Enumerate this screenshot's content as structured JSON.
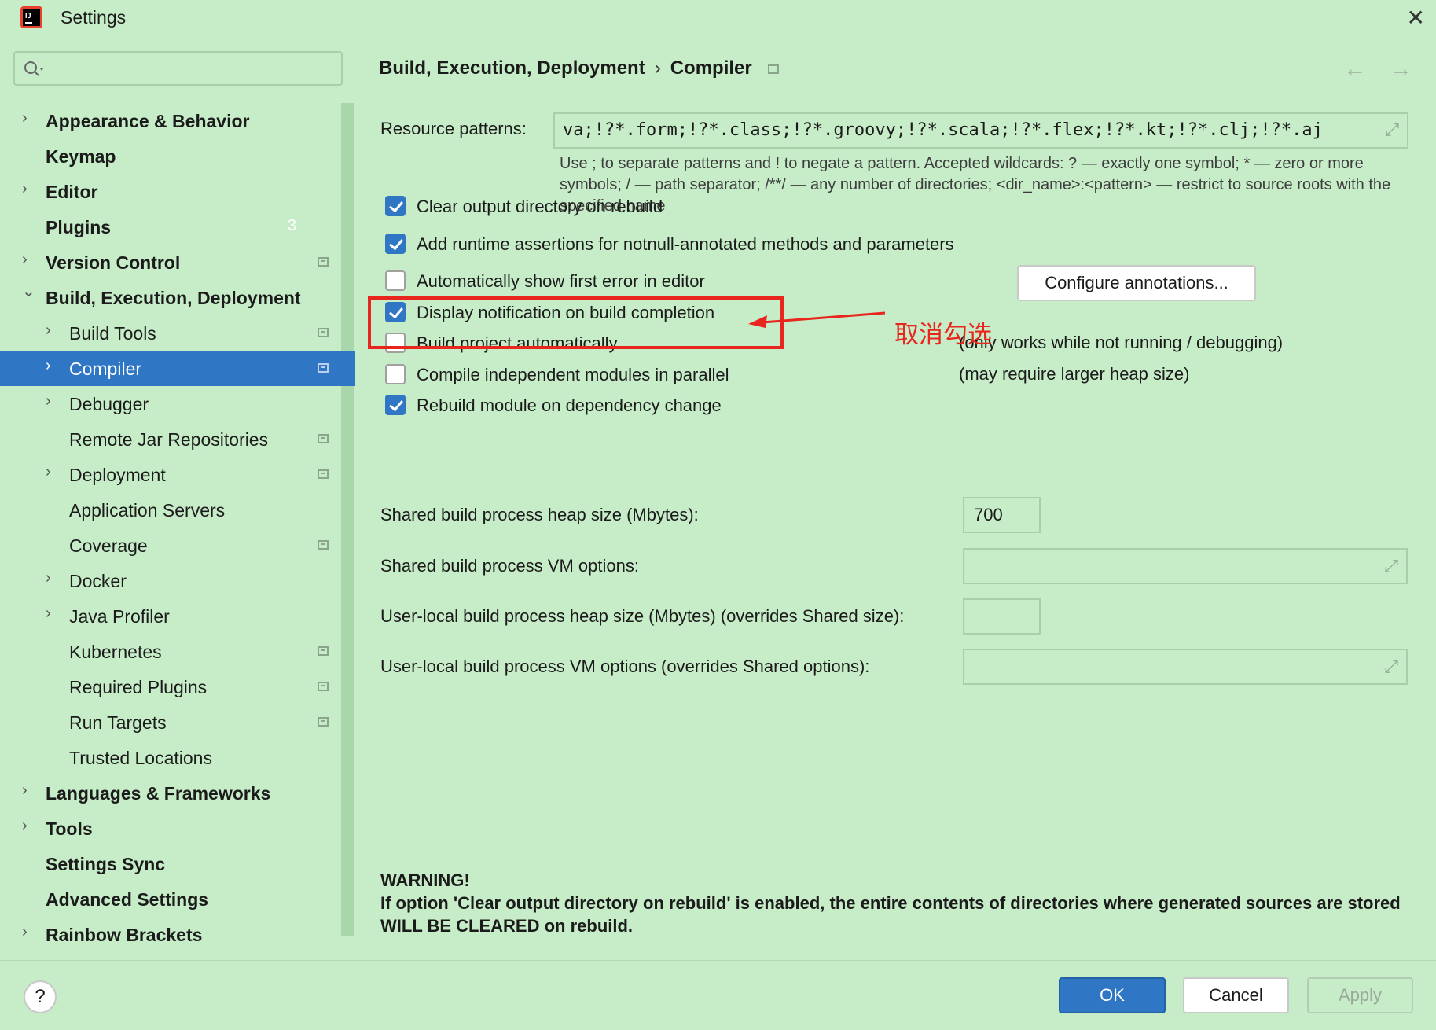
{
  "window": {
    "title": "Settings",
    "close_icon": "close-icon",
    "app_icon": "intellij-logo-icon"
  },
  "sidebar": {
    "search_placeholder": "",
    "items": [
      {
        "label": "Appearance & Behavior",
        "level": 0,
        "expandable": true,
        "expanded": false
      },
      {
        "label": "Keymap",
        "level": 0,
        "expandable": false
      },
      {
        "label": "Editor",
        "level": 0,
        "expandable": true,
        "expanded": false
      },
      {
        "label": "Plugins",
        "level": 0,
        "expandable": false,
        "count": "3"
      },
      {
        "label": "Version Control",
        "level": 0,
        "expandable": true,
        "expanded": false,
        "project_icon": true
      },
      {
        "label": "Build, Execution, Deployment",
        "level": 0,
        "expandable": true,
        "expanded": true
      },
      {
        "label": "Build Tools",
        "level": 1,
        "expandable": true,
        "expanded": false,
        "project_icon": true
      },
      {
        "label": "Compiler",
        "level": 1,
        "expandable": true,
        "expanded": false,
        "project_icon": true,
        "selected": true
      },
      {
        "label": "Debugger",
        "level": 1,
        "expandable": true,
        "expanded": false
      },
      {
        "label": "Remote Jar Repositories",
        "level": 1,
        "expandable": false,
        "project_icon": true
      },
      {
        "label": "Deployment",
        "level": 1,
        "expandable": true,
        "expanded": false,
        "project_icon": true
      },
      {
        "label": "Application Servers",
        "level": 1,
        "expandable": false
      },
      {
        "label": "Coverage",
        "level": 1,
        "expandable": false,
        "project_icon": true
      },
      {
        "label": "Docker",
        "level": 1,
        "expandable": true,
        "expanded": false
      },
      {
        "label": "Java Profiler",
        "level": 1,
        "expandable": true,
        "expanded": false
      },
      {
        "label": "Kubernetes",
        "level": 1,
        "expandable": false,
        "project_icon": true
      },
      {
        "label": "Required Plugins",
        "level": 1,
        "expandable": false,
        "project_icon": true
      },
      {
        "label": "Run Targets",
        "level": 1,
        "expandable": false,
        "project_icon": true
      },
      {
        "label": "Trusted Locations",
        "level": 1,
        "expandable": false
      },
      {
        "label": "Languages & Frameworks",
        "level": 0,
        "expandable": true,
        "expanded": false
      },
      {
        "label": "Tools",
        "level": 0,
        "expandable": true,
        "expanded": false
      },
      {
        "label": "Settings Sync",
        "level": 0,
        "expandable": false
      },
      {
        "label": "Advanced Settings",
        "level": 0,
        "expandable": false
      },
      {
        "label": "Rainbow Brackets",
        "level": 0,
        "expandable": true,
        "expanded": false
      }
    ]
  },
  "content": {
    "breadcrumb": {
      "parent": "Build, Execution, Deployment",
      "separator": "›",
      "current": "Compiler"
    },
    "resource_patterns": {
      "label": "Resource patterns:",
      "value": "va;!?*.form;!?*.class;!?*.groovy;!?*.scala;!?*.flex;!?*.kt;!?*.clj;!?*.aj",
      "help": "Use ; to separate patterns and ! to negate a pattern. Accepted wildcards: ? — exactly one symbol; * — zero or more symbols; / — path separator; /**/ — any number of directories; <dir_name>:<pattern> — restrict to source roots with the specified name"
    },
    "checkboxes": [
      {
        "label": "Clear output directory on rebuild",
        "checked": true
      },
      {
        "label": "Add runtime assertions for notnull-annotated methods and parameters",
        "checked": true
      },
      {
        "label": "Automatically show first error in editor",
        "checked": false
      },
      {
        "label": "Display notification on build completion",
        "checked": true
      },
      {
        "label": "Build project automatically",
        "checked": false,
        "note": "(only works while not running / debugging)"
      },
      {
        "label": "Compile independent modules in parallel",
        "checked": false,
        "note": "(may require larger heap size)"
      },
      {
        "label": "Rebuild module on dependency change",
        "checked": true
      }
    ],
    "configure_button": "Configure annotations...",
    "fields": {
      "heap_label": "Shared build process heap size (Mbytes):",
      "heap_value": "700",
      "vm_label": "Shared build process VM options:",
      "vm_value": "",
      "ul_heap_label": "User-local build process heap size (Mbytes) (overrides Shared size):",
      "ul_heap_value": "",
      "ul_vm_label": "User-local build process VM options (overrides Shared options):",
      "ul_vm_value": ""
    },
    "warning": {
      "title": "WARNING!",
      "body": "If option 'Clear output directory on rebuild' is enabled, the entire contents of directories where generated sources are stored WILL BE CLEARED on rebuild."
    }
  },
  "annotation": {
    "text": "取消勾选",
    "color": "#e8261e"
  },
  "footer": {
    "help": "?",
    "ok": "OK",
    "cancel": "Cancel",
    "apply": "Apply"
  },
  "colors": {
    "background": "#c7ecc8",
    "accent": "#2f76c5"
  }
}
